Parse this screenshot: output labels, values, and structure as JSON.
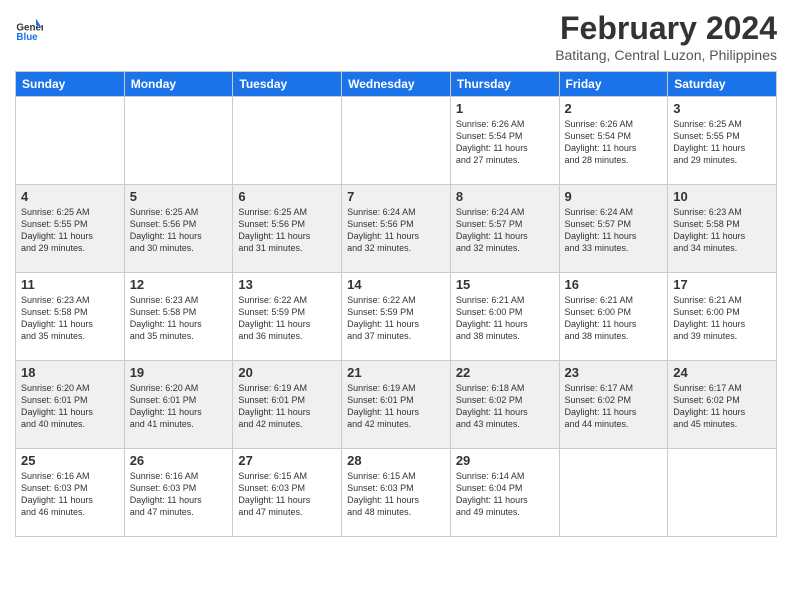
{
  "header": {
    "logo_line1": "General",
    "logo_line2": "Blue",
    "month": "February 2024",
    "location": "Batitang, Central Luzon, Philippines"
  },
  "weekdays": [
    "Sunday",
    "Monday",
    "Tuesday",
    "Wednesday",
    "Thursday",
    "Friday",
    "Saturday"
  ],
  "weeks": [
    [
      {
        "day": "",
        "text": ""
      },
      {
        "day": "",
        "text": ""
      },
      {
        "day": "",
        "text": ""
      },
      {
        "day": "",
        "text": ""
      },
      {
        "day": "1",
        "text": "Sunrise: 6:26 AM\nSunset: 5:54 PM\nDaylight: 11 hours\nand 27 minutes."
      },
      {
        "day": "2",
        "text": "Sunrise: 6:26 AM\nSunset: 5:54 PM\nDaylight: 11 hours\nand 28 minutes."
      },
      {
        "day": "3",
        "text": "Sunrise: 6:25 AM\nSunset: 5:55 PM\nDaylight: 11 hours\nand 29 minutes."
      }
    ],
    [
      {
        "day": "4",
        "text": "Sunrise: 6:25 AM\nSunset: 5:55 PM\nDaylight: 11 hours\nand 29 minutes."
      },
      {
        "day": "5",
        "text": "Sunrise: 6:25 AM\nSunset: 5:56 PM\nDaylight: 11 hours\nand 30 minutes."
      },
      {
        "day": "6",
        "text": "Sunrise: 6:25 AM\nSunset: 5:56 PM\nDaylight: 11 hours\nand 31 minutes."
      },
      {
        "day": "7",
        "text": "Sunrise: 6:24 AM\nSunset: 5:56 PM\nDaylight: 11 hours\nand 32 minutes."
      },
      {
        "day": "8",
        "text": "Sunrise: 6:24 AM\nSunset: 5:57 PM\nDaylight: 11 hours\nand 32 minutes."
      },
      {
        "day": "9",
        "text": "Sunrise: 6:24 AM\nSunset: 5:57 PM\nDaylight: 11 hours\nand 33 minutes."
      },
      {
        "day": "10",
        "text": "Sunrise: 6:23 AM\nSunset: 5:58 PM\nDaylight: 11 hours\nand 34 minutes."
      }
    ],
    [
      {
        "day": "11",
        "text": "Sunrise: 6:23 AM\nSunset: 5:58 PM\nDaylight: 11 hours\nand 35 minutes."
      },
      {
        "day": "12",
        "text": "Sunrise: 6:23 AM\nSunset: 5:58 PM\nDaylight: 11 hours\nand 35 minutes."
      },
      {
        "day": "13",
        "text": "Sunrise: 6:22 AM\nSunset: 5:59 PM\nDaylight: 11 hours\nand 36 minutes."
      },
      {
        "day": "14",
        "text": "Sunrise: 6:22 AM\nSunset: 5:59 PM\nDaylight: 11 hours\nand 37 minutes."
      },
      {
        "day": "15",
        "text": "Sunrise: 6:21 AM\nSunset: 6:00 PM\nDaylight: 11 hours\nand 38 minutes."
      },
      {
        "day": "16",
        "text": "Sunrise: 6:21 AM\nSunset: 6:00 PM\nDaylight: 11 hours\nand 38 minutes."
      },
      {
        "day": "17",
        "text": "Sunrise: 6:21 AM\nSunset: 6:00 PM\nDaylight: 11 hours\nand 39 minutes."
      }
    ],
    [
      {
        "day": "18",
        "text": "Sunrise: 6:20 AM\nSunset: 6:01 PM\nDaylight: 11 hours\nand 40 minutes."
      },
      {
        "day": "19",
        "text": "Sunrise: 6:20 AM\nSunset: 6:01 PM\nDaylight: 11 hours\nand 41 minutes."
      },
      {
        "day": "20",
        "text": "Sunrise: 6:19 AM\nSunset: 6:01 PM\nDaylight: 11 hours\nand 42 minutes."
      },
      {
        "day": "21",
        "text": "Sunrise: 6:19 AM\nSunset: 6:01 PM\nDaylight: 11 hours\nand 42 minutes."
      },
      {
        "day": "22",
        "text": "Sunrise: 6:18 AM\nSunset: 6:02 PM\nDaylight: 11 hours\nand 43 minutes."
      },
      {
        "day": "23",
        "text": "Sunrise: 6:17 AM\nSunset: 6:02 PM\nDaylight: 11 hours\nand 44 minutes."
      },
      {
        "day": "24",
        "text": "Sunrise: 6:17 AM\nSunset: 6:02 PM\nDaylight: 11 hours\nand 45 minutes."
      }
    ],
    [
      {
        "day": "25",
        "text": "Sunrise: 6:16 AM\nSunset: 6:03 PM\nDaylight: 11 hours\nand 46 minutes."
      },
      {
        "day": "26",
        "text": "Sunrise: 6:16 AM\nSunset: 6:03 PM\nDaylight: 11 hours\nand 47 minutes."
      },
      {
        "day": "27",
        "text": "Sunrise: 6:15 AM\nSunset: 6:03 PM\nDaylight: 11 hours\nand 47 minutes."
      },
      {
        "day": "28",
        "text": "Sunrise: 6:15 AM\nSunset: 6:03 PM\nDaylight: 11 hours\nand 48 minutes."
      },
      {
        "day": "29",
        "text": "Sunrise: 6:14 AM\nSunset: 6:04 PM\nDaylight: 11 hours\nand 49 minutes."
      },
      {
        "day": "",
        "text": ""
      },
      {
        "day": "",
        "text": ""
      }
    ]
  ]
}
